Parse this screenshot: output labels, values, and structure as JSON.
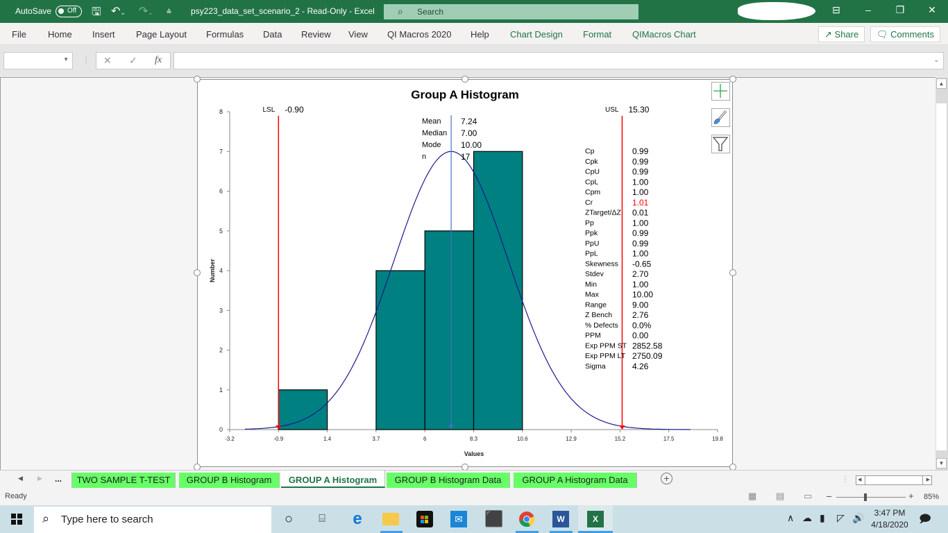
{
  "titlebar": {
    "autosave_label": "AutoSave",
    "autosave_state": "Off",
    "doc_title": "psy223_data_set_scenario_2  -  Read-Only  -  Excel",
    "search_placeholder": "Search"
  },
  "ribbon": {
    "tabs": [
      "File",
      "Home",
      "Insert",
      "Page Layout",
      "Formulas",
      "Data",
      "Review",
      "View",
      "QI Macros 2020",
      "Help",
      "Chart Design",
      "Format",
      "QIMacros Chart"
    ],
    "share_label": "Share",
    "comments_label": "Comments"
  },
  "formula_bar": {
    "name_box_value": "",
    "formula_value": "",
    "fx_label": "fx"
  },
  "chart_data": {
    "type": "bar",
    "title": "Group A Histogram",
    "xlabel": "Values",
    "ylabel": "Number",
    "xlim": [
      -3.2,
      19.8
    ],
    "ylim": [
      0,
      8
    ],
    "x_ticks": [
      "-3.2",
      "-0.9",
      "1.4",
      "3.7",
      "6",
      "8.3",
      "10.6",
      "12.9",
      "15.2",
      "17.5",
      "19.8"
    ],
    "y_ticks": [
      "0",
      "1",
      "2",
      "3",
      "4",
      "5",
      "6",
      "7",
      "8"
    ],
    "bins": [
      {
        "from": -0.9,
        "to": 1.4,
        "count": 1
      },
      {
        "from": 1.4,
        "to": 3.7,
        "count": 0
      },
      {
        "from": 3.7,
        "to": 6.0,
        "count": 4
      },
      {
        "from": 6.0,
        "to": 8.3,
        "count": 5
      },
      {
        "from": 8.3,
        "to": 10.6,
        "count": 7
      }
    ],
    "bar_color": "#008080",
    "normal_curve": {
      "mean": 7.24,
      "stdev": 2.7,
      "peak": 7.0,
      "color": "#1a1a8c"
    },
    "lsl": {
      "label": "LSL",
      "value": -0.9,
      "display": "-0.90",
      "color": "#ff0000"
    },
    "usl": {
      "label": "USL",
      "value": 15.3,
      "display": "15.30",
      "color": "#ff0000"
    },
    "mean_line": {
      "value": 7.24,
      "color": "#4472c4"
    },
    "summary": [
      {
        "label": "Mean",
        "value": "7.24"
      },
      {
        "label": "Median",
        "value": "7.00"
      },
      {
        "label": "Mode",
        "value": "10.00"
      },
      {
        "label": "n",
        "value": "17"
      }
    ],
    "capability": [
      {
        "label": "Cp",
        "value": "0.99"
      },
      {
        "label": "Cpk",
        "value": "0.99"
      },
      {
        "label": "CpU",
        "value": "0.99"
      },
      {
        "label": "CpL",
        "value": "1.00"
      },
      {
        "label": "Cpm",
        "value": "1.00"
      },
      {
        "label": "Cr",
        "value": "1.01",
        "highlight": "#ff0000"
      },
      {
        "label": "ZTarget/ΔZ",
        "value": "0.01"
      },
      {
        "label": "Pp",
        "value": "1.00"
      },
      {
        "label": "Ppk",
        "value": "0.99"
      },
      {
        "label": "PpU",
        "value": "0.99"
      },
      {
        "label": "PpL",
        "value": "1.00"
      },
      {
        "label": "Skewness",
        "value": "-0.65"
      },
      {
        "label": "Stdev",
        "value": "2.70"
      },
      {
        "label": "Min",
        "value": "1.00"
      },
      {
        "label": "Max",
        "value": "10.00"
      },
      {
        "label": "Range",
        "value": "9.00"
      },
      {
        "label": "Z Bench",
        "value": "2.76"
      },
      {
        "label": "% Defects",
        "value": "0.0%"
      },
      {
        "label": "PPM",
        "value": "0.00"
      },
      {
        "label": "Exp PPM ST",
        "value": "2852.58"
      },
      {
        "label": "Exp PPM LT",
        "value": "2750.09"
      },
      {
        "label": "Sigma",
        "value": "4.26"
      }
    ]
  },
  "chart_side_buttons": [
    "chart-elements",
    "chart-styles",
    "chart-filters"
  ],
  "sheet_tabs": {
    "more_label": "...",
    "tabs": [
      {
        "label": "TWO SAMPLE T-TEST",
        "active": false
      },
      {
        "label": "GROUP B Histogram",
        "active": false
      },
      {
        "label": "GROUP A Histogram",
        "active": true
      },
      {
        "label": "GROUP B Histogram Data",
        "active": false
      },
      {
        "label": "GROUP A Histogram Data",
        "active": false
      }
    ]
  },
  "statusbar": {
    "status": "Ready",
    "zoom_percent": "85%",
    "zoom_value": 85
  },
  "taskbar": {
    "search_placeholder": "Type here to search",
    "time": "3:47 PM",
    "date": "4/18/2020"
  },
  "colors": {
    "excel_green": "#217346",
    "sheet_tab_green": "#66ff66"
  }
}
